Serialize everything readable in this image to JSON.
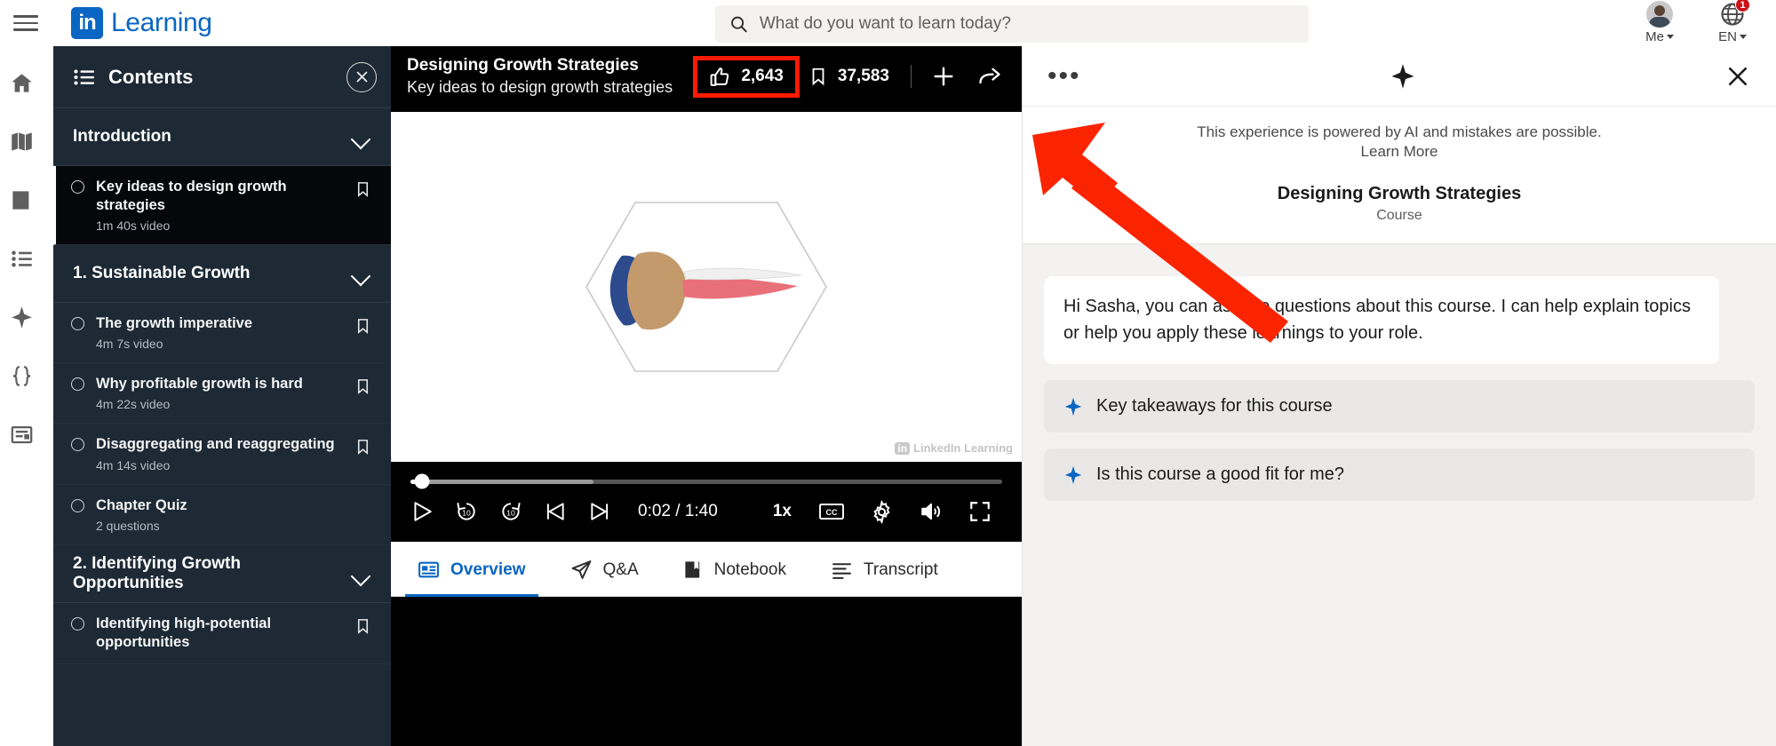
{
  "globalnav": {
    "menu_icon": "hamburger-menu-icon",
    "brand_mark": "in",
    "brand_text": "Learning",
    "search": {
      "icon": "search-icon",
      "placeholder": "What do you want to learn today?",
      "value": ""
    },
    "me": {
      "label": "Me",
      "icon": "avatar"
    },
    "language": {
      "label": "EN",
      "icon": "globe-icon",
      "badge": "1"
    }
  },
  "rail": {
    "items": [
      {
        "name": "home-icon",
        "label": "Home"
      },
      {
        "name": "map-icon",
        "label": "Browse"
      },
      {
        "name": "book-icon",
        "label": "My Library"
      },
      {
        "name": "list-icon",
        "label": "Collections"
      },
      {
        "name": "sparkle-icon",
        "label": "AI Assistant"
      },
      {
        "name": "code-braces-icon",
        "label": "Code Challenges"
      },
      {
        "name": "certificate-icon",
        "label": "Certificates"
      }
    ]
  },
  "contents": {
    "header_title": "Contents",
    "header_icon": "list-icon",
    "close_icon": "close-icon",
    "sections": [
      {
        "title": "Introduction",
        "lessons": [
          {
            "title": "Key ideas to design growth strategies",
            "meta": "1m 40s video",
            "active": true,
            "bookmark": "bookmark-icon"
          }
        ]
      },
      {
        "title": "1. Sustainable Growth",
        "lessons": [
          {
            "title": "The growth imperative",
            "meta": "4m 7s video",
            "active": false,
            "bookmark": "bookmark-icon"
          },
          {
            "title": "Why profitable growth is hard",
            "meta": "4m 22s video",
            "active": false,
            "bookmark": "bookmark-icon"
          },
          {
            "title": "Disaggregating and reaggregating",
            "meta": "4m 14s video",
            "active": false,
            "bookmark": "bookmark-icon"
          },
          {
            "title": "Chapter Quiz",
            "meta": "2 questions",
            "active": false,
            "bookmark": ""
          }
        ]
      },
      {
        "title": "2. Identifying Growth Opportunities",
        "lessons": [
          {
            "title": "Identifying high-potential opportunities",
            "meta": "",
            "active": false,
            "bookmark": "bookmark-icon"
          }
        ]
      }
    ]
  },
  "video": {
    "title": "Designing Growth Strategies",
    "subtitle": "Key ideas to design growth strategies",
    "likes": {
      "icon": "thumbs-up-icon",
      "count": "2,643",
      "highlighted": true
    },
    "saves": {
      "icon": "bookmark-icon",
      "count": "37,583"
    },
    "add_icon": "plus-icon",
    "share_icon": "share-arrow-icon",
    "watermark": "LinkedIn Learning",
    "controls": {
      "play_icon": "play-icon",
      "rewind_icon": "rewind-10-icon",
      "forward_icon": "forward-10-icon",
      "prev_icon": "previous-video-icon",
      "next_icon": "next-video-icon",
      "current_time": "0:02",
      "time_separator": "/",
      "total_time": "1:40",
      "time_display": "0:02 / 1:40",
      "speed": "1x",
      "cc_icon": "closed-captions-icon",
      "settings_icon": "gear-icon",
      "volume_icon": "volume-icon",
      "fullscreen_icon": "fullscreen-icon",
      "progress_percent": 2,
      "buffered_percent": 31
    },
    "tabs": [
      {
        "label": "Overview",
        "icon": "overview-icon",
        "active": true
      },
      {
        "label": "Q&A",
        "icon": "send-icon",
        "active": false
      },
      {
        "label": "Notebook",
        "icon": "notebook-icon",
        "active": false
      },
      {
        "label": "Transcript",
        "icon": "transcript-icon",
        "active": false
      }
    ]
  },
  "ai": {
    "menu_icon": "more-options-icon",
    "sparkle_icon": "sparkle-icon",
    "close_icon": "close-icon",
    "disclaimer": "This experience is powered by AI and mistakes are possible.",
    "learn_more": "Learn More",
    "course_title": "Designing Growth Strategies",
    "course_type": "Course",
    "greeting": "Hi Sasha, you can ask me questions about this course. I can help explain topics or help you apply these learnings to your role.",
    "suggestions": [
      {
        "label": "Key takeaways for this course",
        "icon": "sparkle-icon"
      },
      {
        "label": "Is this course a good fit for me?",
        "icon": "sparkle-icon"
      }
    ]
  },
  "annotation": {
    "arrow_color": "#fb2400",
    "highlight_color": "#ff1a00",
    "target": "likes-stat"
  },
  "colors": {
    "brand_blue": "#0a66c2",
    "panel_dark": "#1d2935",
    "active_lesson": "#05070a",
    "ai_bg": "#f3f2f0",
    "badge_red": "#cc1016"
  }
}
